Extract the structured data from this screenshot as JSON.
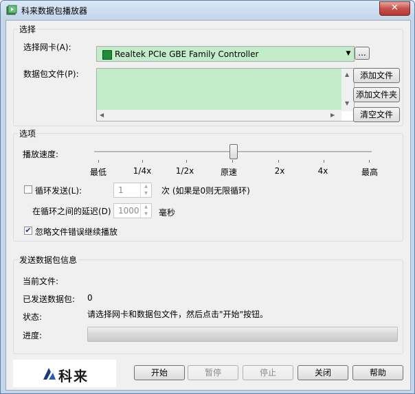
{
  "window": {
    "title": "科来数据包播放器",
    "close_glyph": "✕"
  },
  "select_group": {
    "title": "选择",
    "nic_label": "选择网卡(A):",
    "nic_value": "Realtek PCIe GBE Family Controller",
    "browse_label": "...",
    "file_label": "数据包文件(P):",
    "add_file": "添加文件",
    "add_folder": "添加文件夹",
    "clear_files": "清空文件"
  },
  "options_group": {
    "title": "选项",
    "speed_label": "播放速度:",
    "speed_marks": [
      "最低",
      "1/4x",
      "1/2x",
      "原速",
      "2x",
      "4x",
      "最高"
    ],
    "loop_label": "循环发送(L):",
    "loop_checked": false,
    "loop_count": "1",
    "loop_hint": "次 (如果是0则无限循环)",
    "delay_label": "在循环之间的延迟(D)",
    "delay_value": "1000",
    "delay_unit": "毫秒",
    "ignore_label": "忽略文件错误继续播放",
    "ignore_checked": true
  },
  "info_group": {
    "title": "发送数据包信息",
    "current_file_label": "当前文件:",
    "current_file_value": "",
    "sent_label": "已发送数据包:",
    "sent_value": "0",
    "status_label": "状态:",
    "status_value": "请选择网卡和数据包文件，然后点击\"开始\"按钮。",
    "progress_label": "进度:",
    "progress": 0
  },
  "footer": {
    "logo_text": "科来",
    "start": "开始",
    "pause": "暂停",
    "stop": "停止",
    "close": "关闭",
    "help": "帮助"
  }
}
